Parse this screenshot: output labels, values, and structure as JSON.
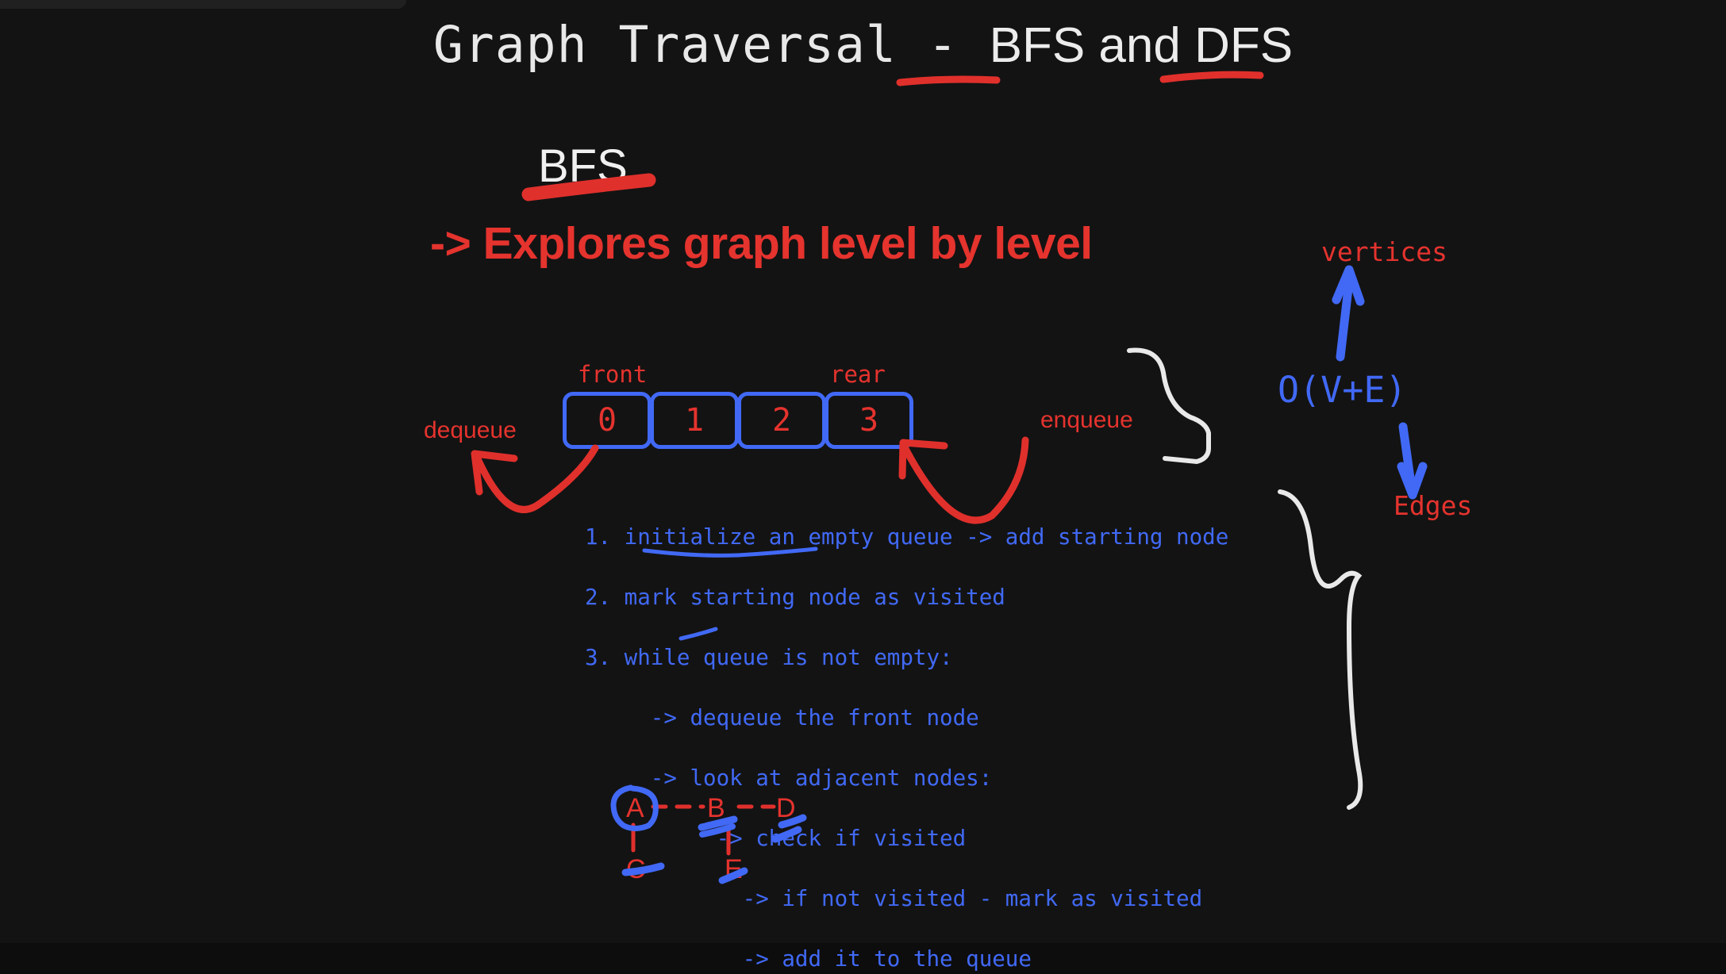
{
  "page": {
    "background_color": "#131313",
    "title_mono_part": "Graph Traversal - ",
    "title_bfs": "BFS",
    "title_and": " and ",
    "title_dfs": "DFS"
  },
  "colors": {
    "red": "#e5332e",
    "blue": "#4169f5",
    "white": "#f0f0f0",
    "background": "#131313"
  },
  "section": {
    "heading": "BFS",
    "description": "-> Explores graph level by level"
  },
  "queue": {
    "front_label": "front",
    "rear_label": "rear",
    "cells": [
      "0",
      "1",
      "2",
      "3"
    ],
    "dequeue_label": "dequeue",
    "enqueue_label": "enqueue"
  },
  "algorithm": {
    "lines": [
      "1. initialize an empty queue -> add starting node",
      "2. mark starting node as visited",
      "3. while queue is not empty:",
      "     -> dequeue the front node",
      "     -> look at adjacent nodes:",
      "          -> check if visited",
      "            -> if not visited - mark as visited",
      "            -> add it to the queue"
    ]
  },
  "complexity": {
    "vertices_label": "vertices",
    "notation": "O(V+E)",
    "edges_label": "Edges"
  },
  "graph": {
    "nodes": [
      {
        "id": "A",
        "label": "A"
      },
      {
        "id": "B",
        "label": "B"
      },
      {
        "id": "C",
        "label": "C"
      },
      {
        "id": "D",
        "label": "D"
      },
      {
        "id": "E",
        "label": "E"
      }
    ]
  }
}
